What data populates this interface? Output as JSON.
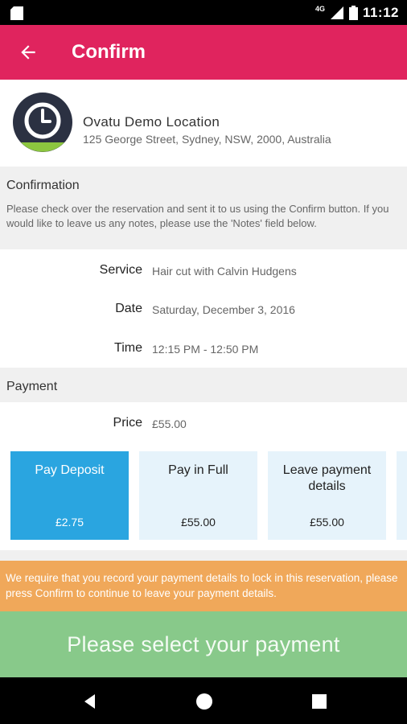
{
  "status_bar": {
    "network": "4G",
    "time": "11:12",
    "icons": [
      "sd-card-icon",
      "signal-icon",
      "battery-icon"
    ]
  },
  "app_bar": {
    "title": "Confirm",
    "back_icon": "arrow-back-icon",
    "color": "#e0245e"
  },
  "location": {
    "logo_icon": "clock-icon",
    "name": "Ovatu Demo Location",
    "address": "125 George Street, Sydney, NSW, 2000, Australia"
  },
  "confirmation": {
    "heading": "Confirmation",
    "description": "Please check over the reservation and sent it to us using the Confirm button. If you would like to leave us any notes, please use the 'Notes' field below.",
    "details": [
      {
        "label": "Service",
        "value": "Hair cut with Calvin Hudgens"
      },
      {
        "label": "Date",
        "value": "Saturday, December 3, 2016"
      },
      {
        "label": "Time",
        "value": "12:15 PM - 12:50 PM"
      }
    ]
  },
  "payment": {
    "heading": "Payment",
    "price_label": "Price",
    "price_value": "£55.00",
    "options": [
      {
        "label": "Pay Deposit",
        "amount": "£2.75",
        "selected": true
      },
      {
        "label": "Pay in Full",
        "amount": "£55.00",
        "selected": false
      },
      {
        "label": "Leave payment details",
        "amount": "£55.00",
        "selected": false
      }
    ]
  },
  "warning": {
    "text": "We require that you record your payment details to lock in this reservation, please press Confirm to continue to leave your payment details.",
    "color": "#f0a85a"
  },
  "cta": {
    "label": "Please select your payment",
    "color": "#88c98a"
  },
  "nav_bar": {
    "icons": [
      "back-triangle-icon",
      "home-circle-icon",
      "recents-square-icon"
    ]
  }
}
